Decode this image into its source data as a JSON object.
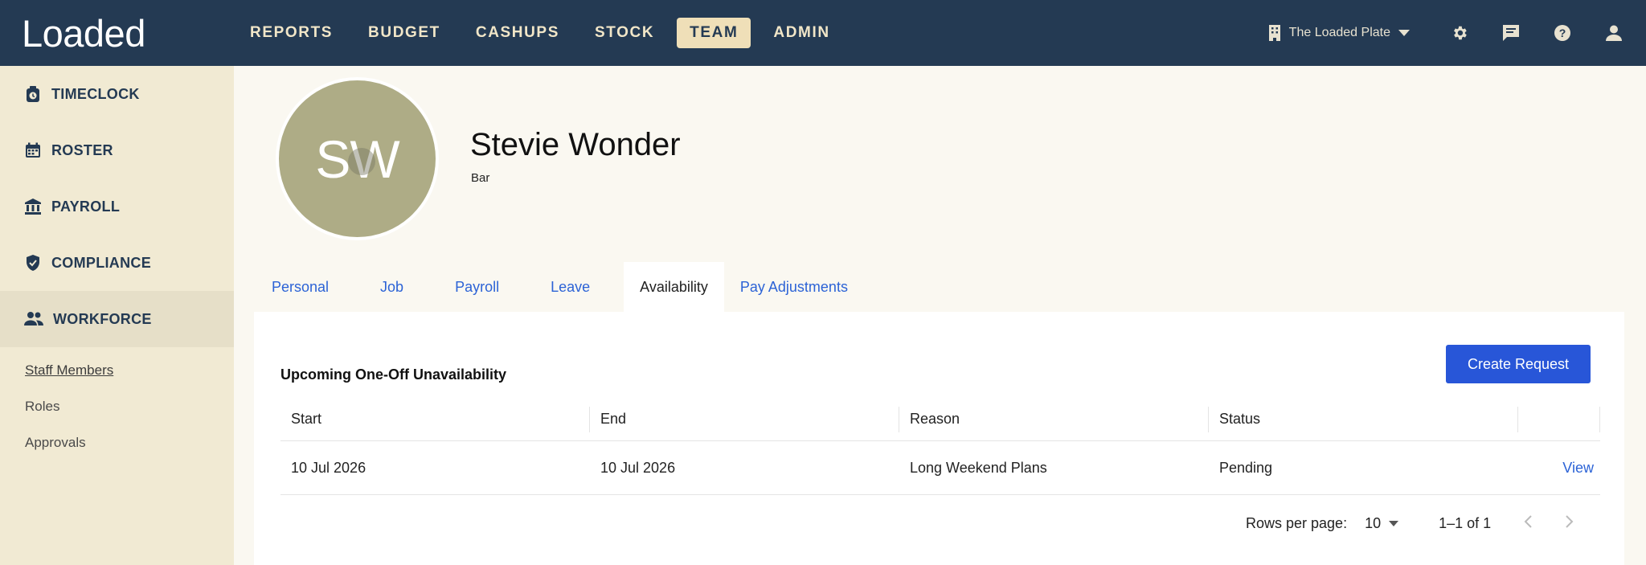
{
  "app": {
    "logo": "Loaded"
  },
  "nav": {
    "items": [
      {
        "label": "REPORTS"
      },
      {
        "label": "BUDGET"
      },
      {
        "label": "CASHUPS"
      },
      {
        "label": "STOCK"
      },
      {
        "label": "TEAM"
      },
      {
        "label": "ADMIN"
      }
    ],
    "active": "TEAM"
  },
  "header": {
    "venue": "The Loaded Plate",
    "icons": [
      "building-icon",
      "gear-icon",
      "chat-icon",
      "help-icon",
      "user-icon"
    ]
  },
  "sidebar": {
    "items": [
      {
        "label": "TIMECLOCK",
        "icon": "timeclock-icon"
      },
      {
        "label": "ROSTER",
        "icon": "calendar-icon"
      },
      {
        "label": "PAYROLL",
        "icon": "bank-icon"
      },
      {
        "label": "COMPLIANCE",
        "icon": "shield-icon"
      },
      {
        "label": "WORKFORCE",
        "icon": "people-icon"
      }
    ],
    "subitems": [
      {
        "label": "Staff Members"
      },
      {
        "label": "Roles"
      },
      {
        "label": "Approvals"
      }
    ]
  },
  "profile": {
    "initials": "SW",
    "name": "Stevie Wonder",
    "role": "Bar"
  },
  "tabs": [
    {
      "label": "Personal"
    },
    {
      "label": "Job"
    },
    {
      "label": "Payroll"
    },
    {
      "label": "Leave"
    },
    {
      "label": "Availability"
    },
    {
      "label": "Pay Adjustments"
    }
  ],
  "panel": {
    "title": "Upcoming One-Off Unavailability",
    "create_button": "Create Request",
    "columns": [
      "Start",
      "End",
      "Reason",
      "Status",
      ""
    ],
    "rows": [
      {
        "start": "10 Jul 2026",
        "end": "10 Jul 2026",
        "reason": "Long Weekend Plans",
        "status": "Pending",
        "action": "View"
      }
    ],
    "pagination": {
      "rows_per_page_label": "Rows per page:",
      "rows_per_page": "10",
      "range": "1–1 of 1"
    }
  },
  "colors": {
    "topbar": "#243a53",
    "nav_active_bg": "#efdfb8",
    "sidebar_bg": "#f1ead3",
    "accent_blue": "#2856d8",
    "avatar_bg": "#aeac86"
  }
}
